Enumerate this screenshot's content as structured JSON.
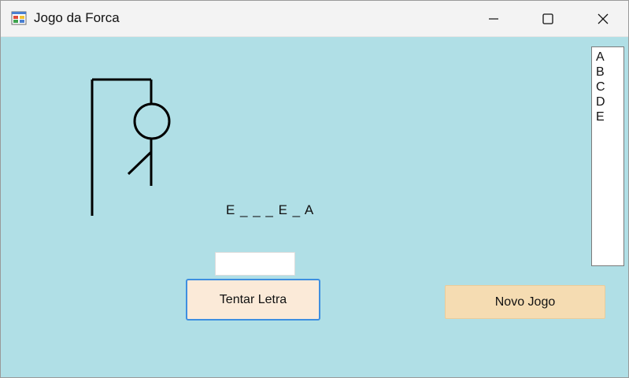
{
  "window": {
    "title": "Jogo da Forca"
  },
  "titlebar": {
    "icons": {
      "app": "app-form-icon",
      "minimize": "minimize-icon",
      "maximize": "maximize-icon",
      "close": "close-icon"
    }
  },
  "game": {
    "word_display": "E _ _ _ E _ A",
    "letter_input_value": "",
    "try_button_label": "Tentar Letra",
    "new_game_button_label": "Novo Jogo",
    "guessed_letters": [
      "A",
      "B",
      "C",
      "D",
      "E"
    ]
  },
  "colors": {
    "form_background": "#b0dfe6",
    "try_button": "#fbead8",
    "try_button_focus_border": "#3e8fe0",
    "new_game_button": "#f5dcb2"
  }
}
